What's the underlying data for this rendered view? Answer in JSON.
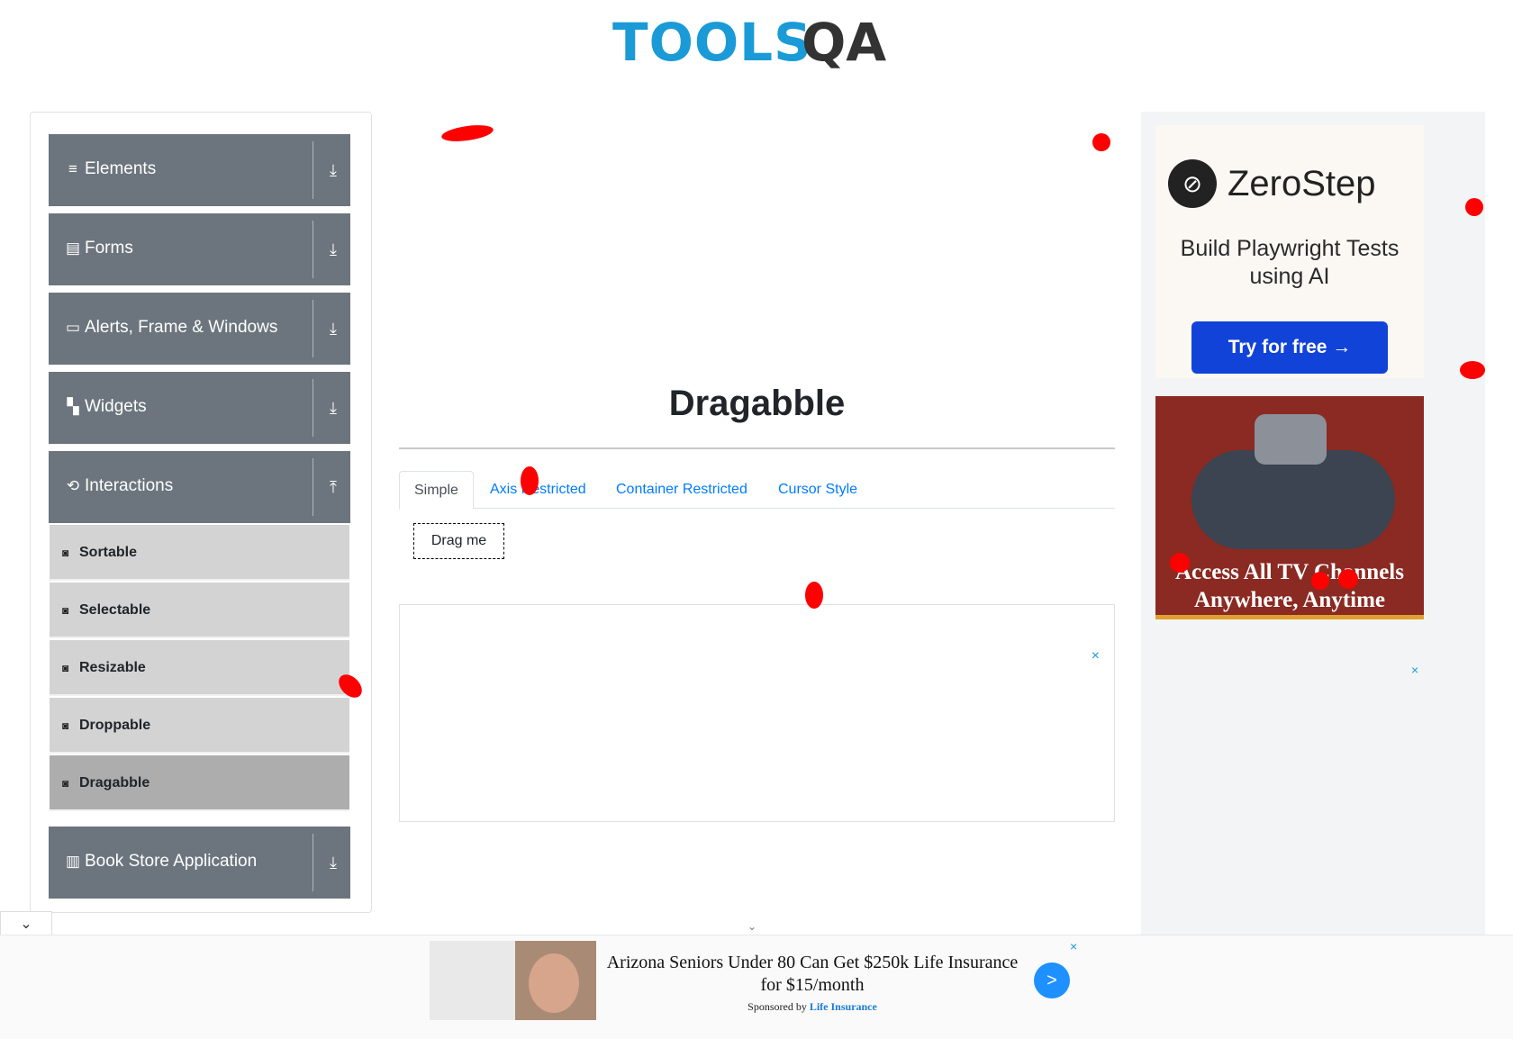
{
  "header": {
    "logo_tools": "TOOLS",
    "logo_qa": "QA"
  },
  "sidebar": {
    "groups": [
      {
        "label": "Elements",
        "icon": "hamburger-icon",
        "arrow": "download-arrow-icon"
      },
      {
        "label": "Forms",
        "icon": "document-icon",
        "arrow": "download-arrow-icon"
      },
      {
        "label": "Alerts, Frame & Windows",
        "icon": "window-icon",
        "arrow": "download-arrow-icon"
      },
      {
        "label": "Widgets",
        "icon": "widgets-icon",
        "arrow": "download-arrow-icon"
      },
      {
        "label": "Interactions",
        "icon": "interactions-icon",
        "arrow": "upload-arrow-icon"
      },
      {
        "label": "Book Store Application",
        "icon": "books-icon",
        "arrow": "download-arrow-icon"
      }
    ],
    "interactions_items": [
      "Sortable",
      "Selectable",
      "Resizable",
      "Droppable",
      "Dragabble"
    ],
    "active_item": "Dragabble"
  },
  "main": {
    "title": "Dragabble",
    "tabs": [
      "Simple",
      "Axis Restricted",
      "Container Restricted",
      "Cursor Style"
    ],
    "active_tab": "Simple",
    "drag_box_label": "Drag me",
    "ad_close": "×"
  },
  "right_ads": {
    "zerostep": {
      "name": "ZeroStep",
      "tagline": "Build Playwright Tests using AI",
      "button": "Try for free →"
    },
    "tv": {
      "headline": "Access All TV Channels Anywhere, Anytime",
      "close": "×"
    },
    "close2": "×"
  },
  "bottom_ad": {
    "title": "Arizona Seniors Under 80 Can Get $250k Life Insurance for $15/month",
    "sponsored_by": "Sponsored by",
    "sponsor": "Life Insurance",
    "go": ">",
    "close": "×"
  },
  "colors": {
    "sidebar_group": "#6c757d",
    "link": "#007bff",
    "brand": "#1a9ad6",
    "marker": "#ff0000"
  }
}
